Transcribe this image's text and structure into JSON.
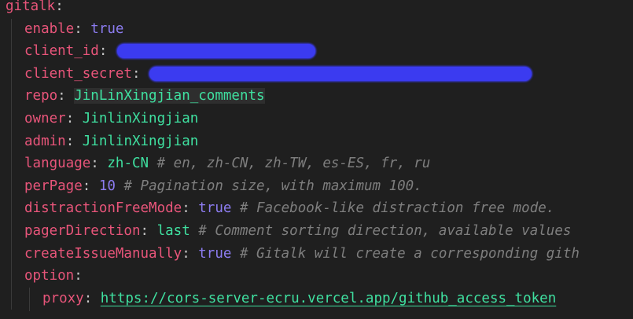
{
  "lines": {
    "gitalk": {
      "key": "gitalk",
      "colon": ":"
    },
    "enable": {
      "key": "enable",
      "colon": ": ",
      "value": "true"
    },
    "client_id": {
      "key": "client_id",
      "colon": ": "
    },
    "client_secret": {
      "key": "client_secret",
      "colon": ": "
    },
    "repo": {
      "key": "repo",
      "colon": ": ",
      "value": "JinLinXingjian_comments"
    },
    "owner": {
      "key": "owner",
      "colon": ": ",
      "value": "JinlinXingjian"
    },
    "admin": {
      "key": "admin",
      "colon": ": ",
      "value": "JinlinXingjian"
    },
    "language": {
      "key": "language",
      "colon": ": ",
      "value": "zh-CN",
      "comment": " # en, zh-CN, zh-TW, es-ES, fr, ru"
    },
    "perPage": {
      "key": "perPage",
      "colon": ": ",
      "value": "10",
      "comment": " # Pagination size, with maximum 100."
    },
    "distractionFreeMode": {
      "key": "distractionFreeMode",
      "colon": ": ",
      "value": "true",
      "comment": " # Facebook-like distraction free mode."
    },
    "pagerDirection": {
      "key": "pagerDirection",
      "colon": ": ",
      "value": "last",
      "comment": " # Comment sorting direction, available values"
    },
    "createIssueManually": {
      "key": "createIssueManually",
      "colon": ": ",
      "value": "true",
      "comment": " # Gitalk will create a corresponding gith"
    },
    "option": {
      "key": "option",
      "colon": ":"
    },
    "proxy": {
      "key": "proxy",
      "colon": ": ",
      "value": "https://cors-server-ecru.vercel.app/github_access_token"
    }
  },
  "colors": {
    "background": "#1f1f1f",
    "key": "#e8557a",
    "boolean": "#8c7cf0",
    "string": "#3fe0a0",
    "comment": "#7e7e7e",
    "redaction": "#3b3bf0"
  }
}
